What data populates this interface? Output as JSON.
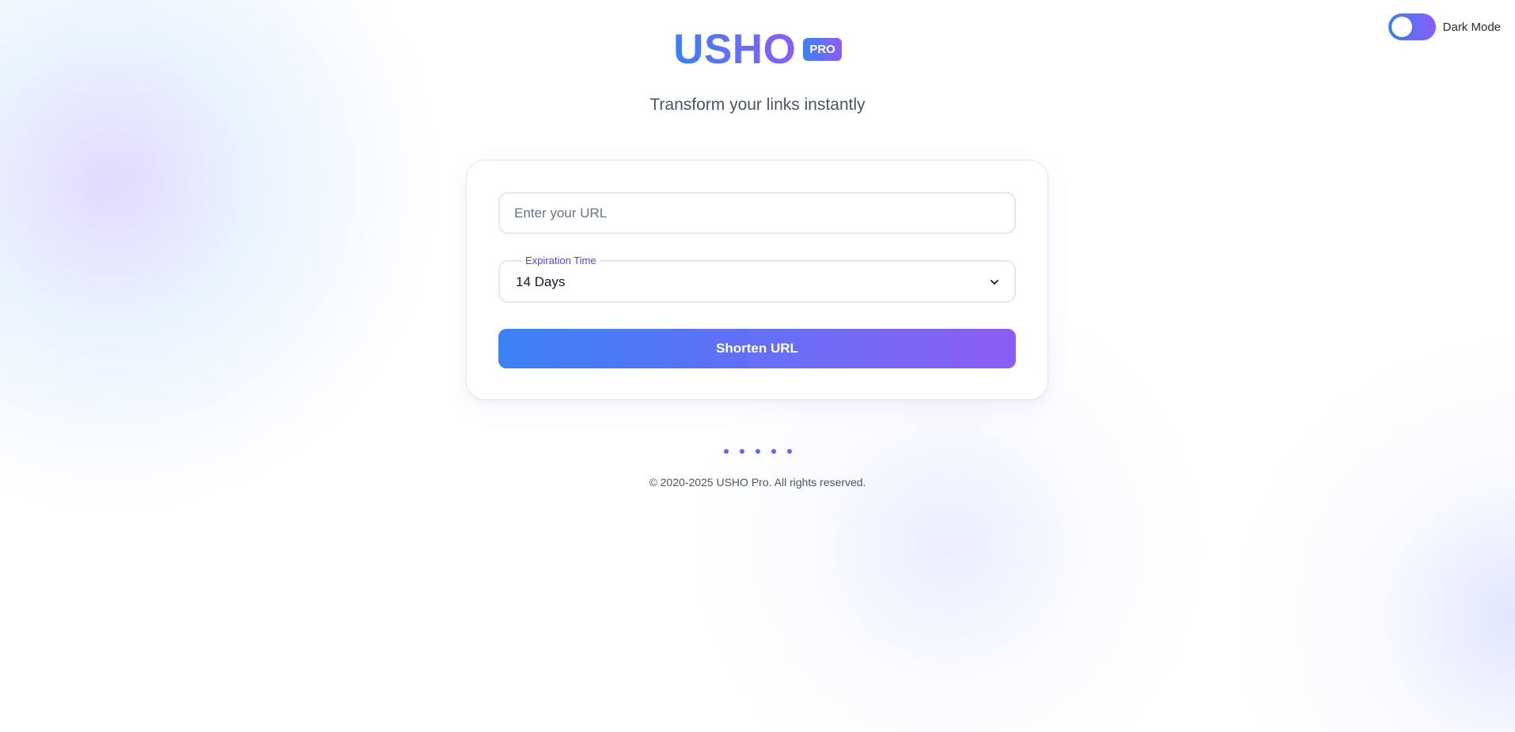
{
  "header": {
    "logo_text": "USHO",
    "badge_text": "PRO",
    "subtitle": "Transform your links instantly"
  },
  "theme_toggle": {
    "label": "Dark Mode",
    "state": "off"
  },
  "form": {
    "url_input": {
      "placeholder": "Enter your URL",
      "value": ""
    },
    "expiration": {
      "label": "Expiration Time",
      "selected": "14 Days"
    },
    "submit_label": "Shorten URL"
  },
  "footer": {
    "copyright": "© 2020-2025 USHO Pro. All rights reserved."
  },
  "colors": {
    "gradient_start": "#3b82f6",
    "gradient_end": "#8b5cf6",
    "accent": "#4f46e5",
    "dot": "#6366f1",
    "text_muted": "#4b5563"
  }
}
